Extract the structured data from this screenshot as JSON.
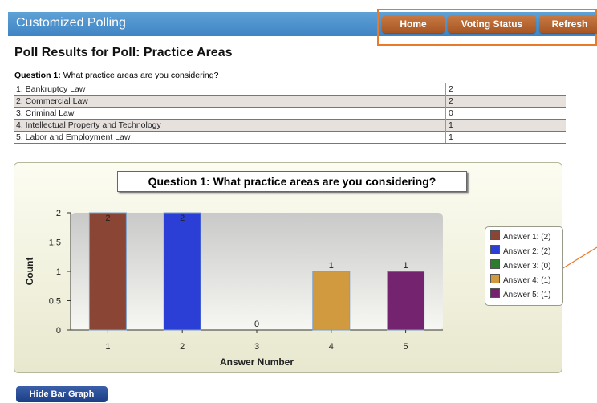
{
  "header": {
    "title": "Customized Polling"
  },
  "nav": {
    "home": "Home",
    "voting_status": "Voting Status",
    "refresh": "Refresh"
  },
  "page": {
    "title": "Poll Results for Poll: Practice Areas"
  },
  "question": {
    "label": "Question 1:",
    "text": "What practice areas are you considering?"
  },
  "results": [
    {
      "answer": "1. Bankruptcy Law",
      "count": "2"
    },
    {
      "answer": "2. Commercial Law",
      "count": "2"
    },
    {
      "answer": "3. Criminal Law",
      "count": "0"
    },
    {
      "answer": "4. Intellectual Property and Technology",
      "count": "1"
    },
    {
      "answer": "5. Labor and Employment Law",
      "count": "1"
    }
  ],
  "chart_data": {
    "type": "bar",
    "title": "Question 1: What practice areas are you considering?",
    "xlabel": "Answer Number",
    "ylabel": "Count",
    "categories": [
      "1",
      "2",
      "3",
      "4",
      "5"
    ],
    "values": [
      2,
      2,
      0,
      1,
      1
    ],
    "ylim": [
      0,
      2
    ],
    "yticks": [
      "0",
      "0.5",
      "1",
      "1.5",
      "2"
    ],
    "colors": [
      "#8b4535",
      "#2b3fd6",
      "#2e7d2e",
      "#d19a3f",
      "#74246f"
    ],
    "legend": [
      "Answer 1: (2)",
      "Answer 2: (2)",
      "Answer 3: (0)",
      "Answer 4: (1)",
      "Answer 5: (1)"
    ],
    "legend_position": "right",
    "grid": false
  },
  "buttons": {
    "hide_bar_graph": "Hide Bar Graph"
  },
  "colors": {
    "accent": "#3f84c4",
    "nav_button": "#b4642f",
    "highlight": "#e97a2a"
  }
}
